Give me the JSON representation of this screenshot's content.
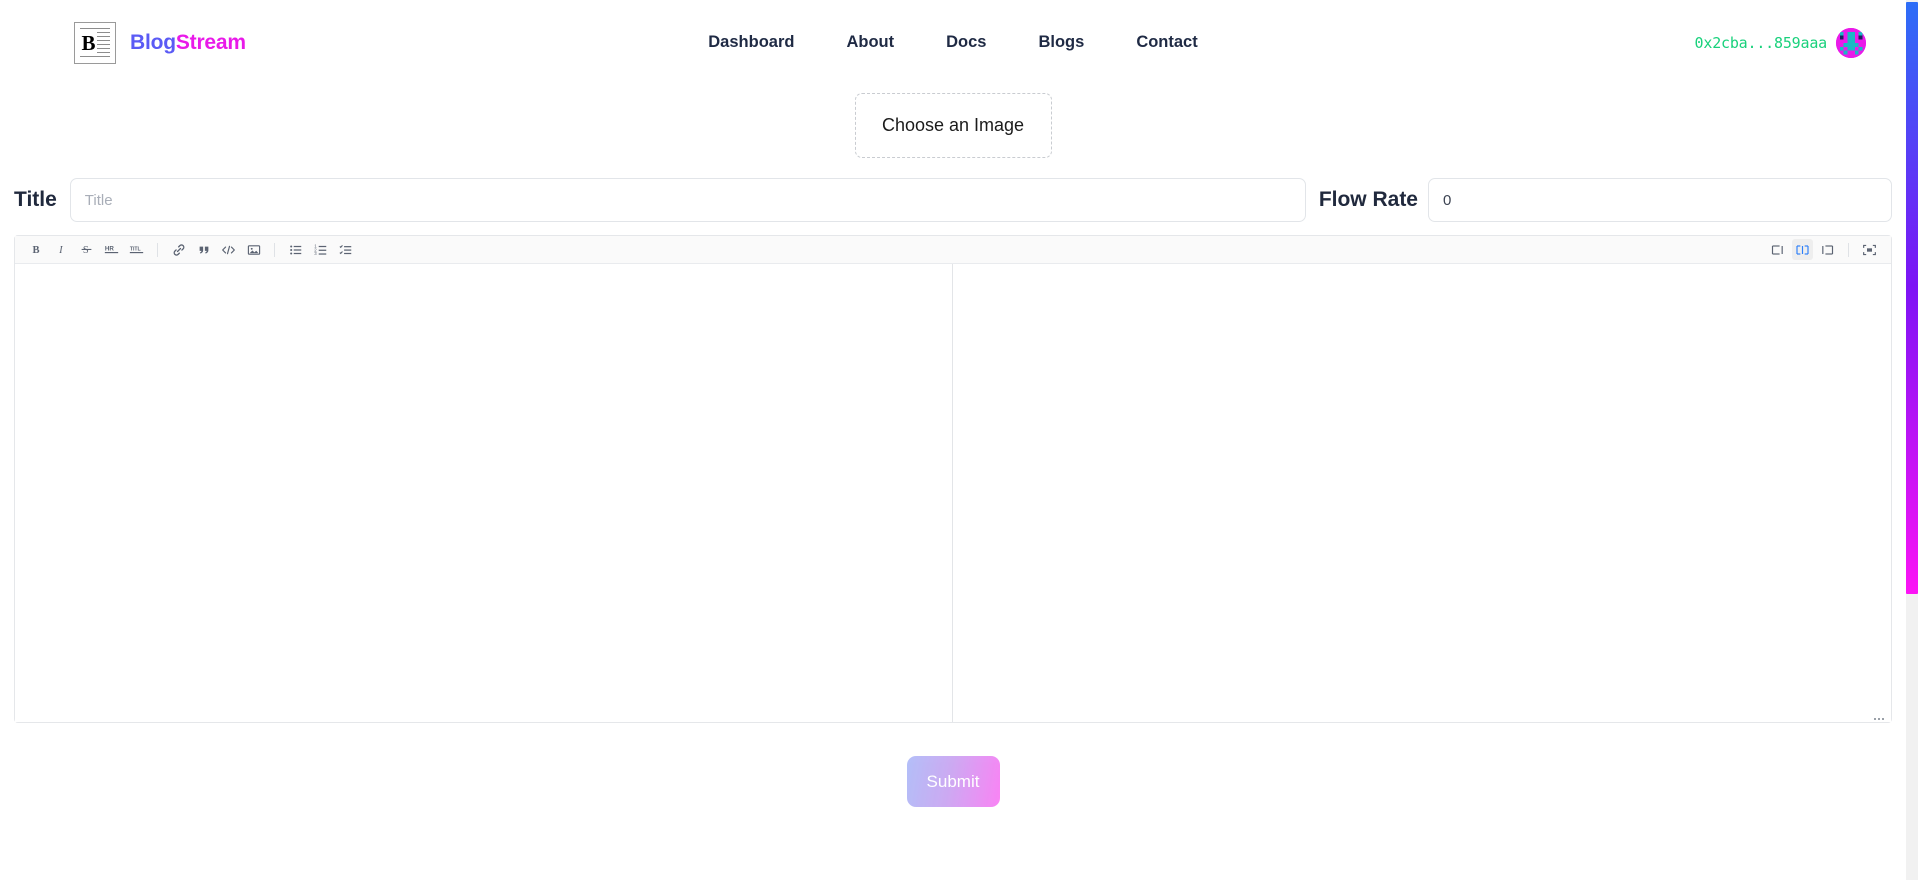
{
  "header": {
    "brand": {
      "logo_icon": "newspaper-document-icon",
      "logo_letter": "B",
      "name_part1": "Blog",
      "name_part2": "Stream"
    },
    "nav": [
      {
        "label": "Dashboard",
        "name": "nav-link-dashboard"
      },
      {
        "label": "About",
        "name": "nav-link-about"
      },
      {
        "label": "Docs",
        "name": "nav-link-docs"
      },
      {
        "label": "Blogs",
        "name": "nav-link-blogs"
      },
      {
        "label": "Contact",
        "name": "nav-link-contact"
      }
    ],
    "wallet": {
      "address": "0x2cba...859aaa",
      "address_color": "#19d17c",
      "avatar_icon": "pixel-blockie-avatar"
    }
  },
  "upload": {
    "dropzone_label": "Choose an Image",
    "dropzone_icon": "dashed-upload-area"
  },
  "form": {
    "title_label": "Title",
    "title_value": "",
    "title_placeholder": "Title",
    "flow_rate_label": "Flow Rate",
    "flow_rate_value": "0",
    "flow_rate_placeholder": "0"
  },
  "editor": {
    "toolbar_left": [
      {
        "name": "bold-icon",
        "label": "B"
      },
      {
        "name": "italic-icon",
        "label": "I"
      },
      {
        "name": "strikethrough-icon",
        "label": "S"
      },
      {
        "name": "horizontal-rule-icon",
        "label": "HR"
      },
      {
        "name": "title-heading-icon",
        "label": "TITL"
      },
      {
        "name": "link-icon",
        "label": "Link"
      },
      {
        "name": "quote-icon",
        "label": "Quote"
      },
      {
        "name": "code-icon",
        "label": "Code"
      },
      {
        "name": "image-icon",
        "label": "Image"
      },
      {
        "name": "unordered-list-icon",
        "label": "Bullet list"
      },
      {
        "name": "ordered-list-icon",
        "label": "Numbered list"
      },
      {
        "name": "checklist-icon",
        "label": "Task list"
      }
    ],
    "toolbar_right": [
      {
        "name": "view-edit-only-icon",
        "label": "Edit only",
        "active": false
      },
      {
        "name": "view-split-icon",
        "label": "Split view",
        "active": true
      },
      {
        "name": "view-preview-only-icon",
        "label": "Preview only",
        "active": false
      },
      {
        "name": "fullscreen-icon",
        "label": "Fullscreen",
        "active": false
      }
    ],
    "content": "",
    "preview_content": "",
    "active_view": "Split view",
    "resize_handle_icon": "resize-grip-icon"
  },
  "actions": {
    "submit_label": "Submit",
    "submit_gradient_from": "#a6b4f7",
    "submit_gradient_to": "#f96ef3"
  },
  "scrollbar": {
    "name": "page-scrollbar",
    "thumb_gradient_from": "#2d6ef7",
    "thumb_gradient_mid": "#7d14f5",
    "thumb_gradient_to": "#fc14f5"
  }
}
